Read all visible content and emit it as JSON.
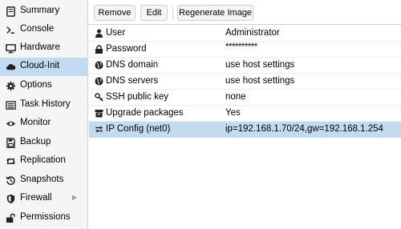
{
  "sidebar": {
    "items": [
      {
        "label": "Summary",
        "icon": "book-icon"
      },
      {
        "label": "Console",
        "icon": "terminal-icon"
      },
      {
        "label": "Hardware",
        "icon": "monitor-icon"
      },
      {
        "label": "Cloud-Init",
        "icon": "cloud-icon",
        "active": true
      },
      {
        "label": "Options",
        "icon": "gear-icon"
      },
      {
        "label": "Task History",
        "icon": "list-icon"
      },
      {
        "label": "Monitor",
        "icon": "eye-icon"
      },
      {
        "label": "Backup",
        "icon": "floppy-icon"
      },
      {
        "label": "Replication",
        "icon": "retweet-icon"
      },
      {
        "label": "Snapshots",
        "icon": "history-icon"
      },
      {
        "label": "Firewall",
        "icon": "shield-icon",
        "expandable": true
      },
      {
        "label": "Permissions",
        "icon": "unlock-icon"
      }
    ]
  },
  "toolbar": {
    "remove_label": "Remove",
    "edit_label": "Edit",
    "regenerate_label": "Regenerate Image"
  },
  "grid": {
    "rows": [
      {
        "key": "User",
        "value": "Administrator",
        "icon": "user-icon"
      },
      {
        "key": "Password",
        "value": "**********",
        "icon": "lock-icon"
      },
      {
        "key": "DNS domain",
        "value": "use host settings",
        "icon": "globe-icon"
      },
      {
        "key": "DNS servers",
        "value": "use host settings",
        "icon": "globe-icon"
      },
      {
        "key": "SSH public key",
        "value": "none",
        "icon": "key-icon"
      },
      {
        "key": "Upgrade packages",
        "value": "Yes",
        "icon": "archive-icon"
      },
      {
        "key": "IP Config (net0)",
        "value": "ip=192.168.1.70/24,gw=192.168.1.254",
        "icon": "exchange-icon",
        "selected": true
      }
    ]
  },
  "colors": {
    "selection": "#c3dbf1",
    "sidebar_bg": "#f5f5f5"
  }
}
